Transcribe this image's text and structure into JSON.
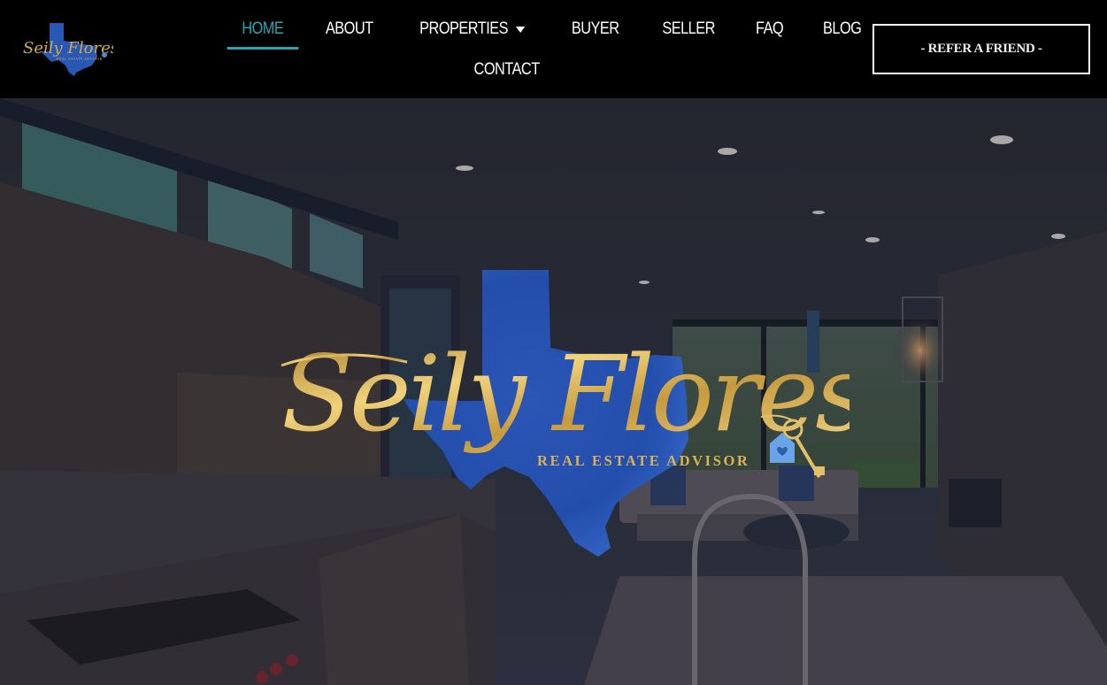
{
  "header": {
    "logo": {
      "script_text": "Seily Flores",
      "sub_text": "REAL ESTATE ADVISOR",
      "icon": "texas-map-logo-icon"
    },
    "nav": {
      "items": [
        {
          "label": "HOME",
          "active": true
        },
        {
          "label": "ABOUT",
          "active": false
        },
        {
          "label": "PROPERTIES",
          "active": false,
          "has_dropdown": true,
          "dropdown_icon": "caret-down-icon"
        },
        {
          "label": "BUYER",
          "active": false
        },
        {
          "label": "SELLER",
          "active": false
        },
        {
          "label": "FAQ",
          "active": false
        },
        {
          "label": "BLOG",
          "active": false
        },
        {
          "label": "CONTACT",
          "active": false
        }
      ]
    },
    "cta_button": {
      "label": "- REFER A FRIEND -"
    }
  },
  "hero": {
    "background": "kitchen-living-room-photo",
    "logo": {
      "script_text": "Seily Flores",
      "tagline": "REAL ESTATE ADVISOR",
      "icons": [
        "texas-map-icon",
        "key-icon",
        "house-tag-icon"
      ]
    }
  },
  "colors": {
    "accent": "#2aa3b3",
    "gold": "#d9b25a",
    "texas_blue": "#2f5fc4",
    "header_bg": "#000000",
    "nav_text": "#ffffff"
  }
}
